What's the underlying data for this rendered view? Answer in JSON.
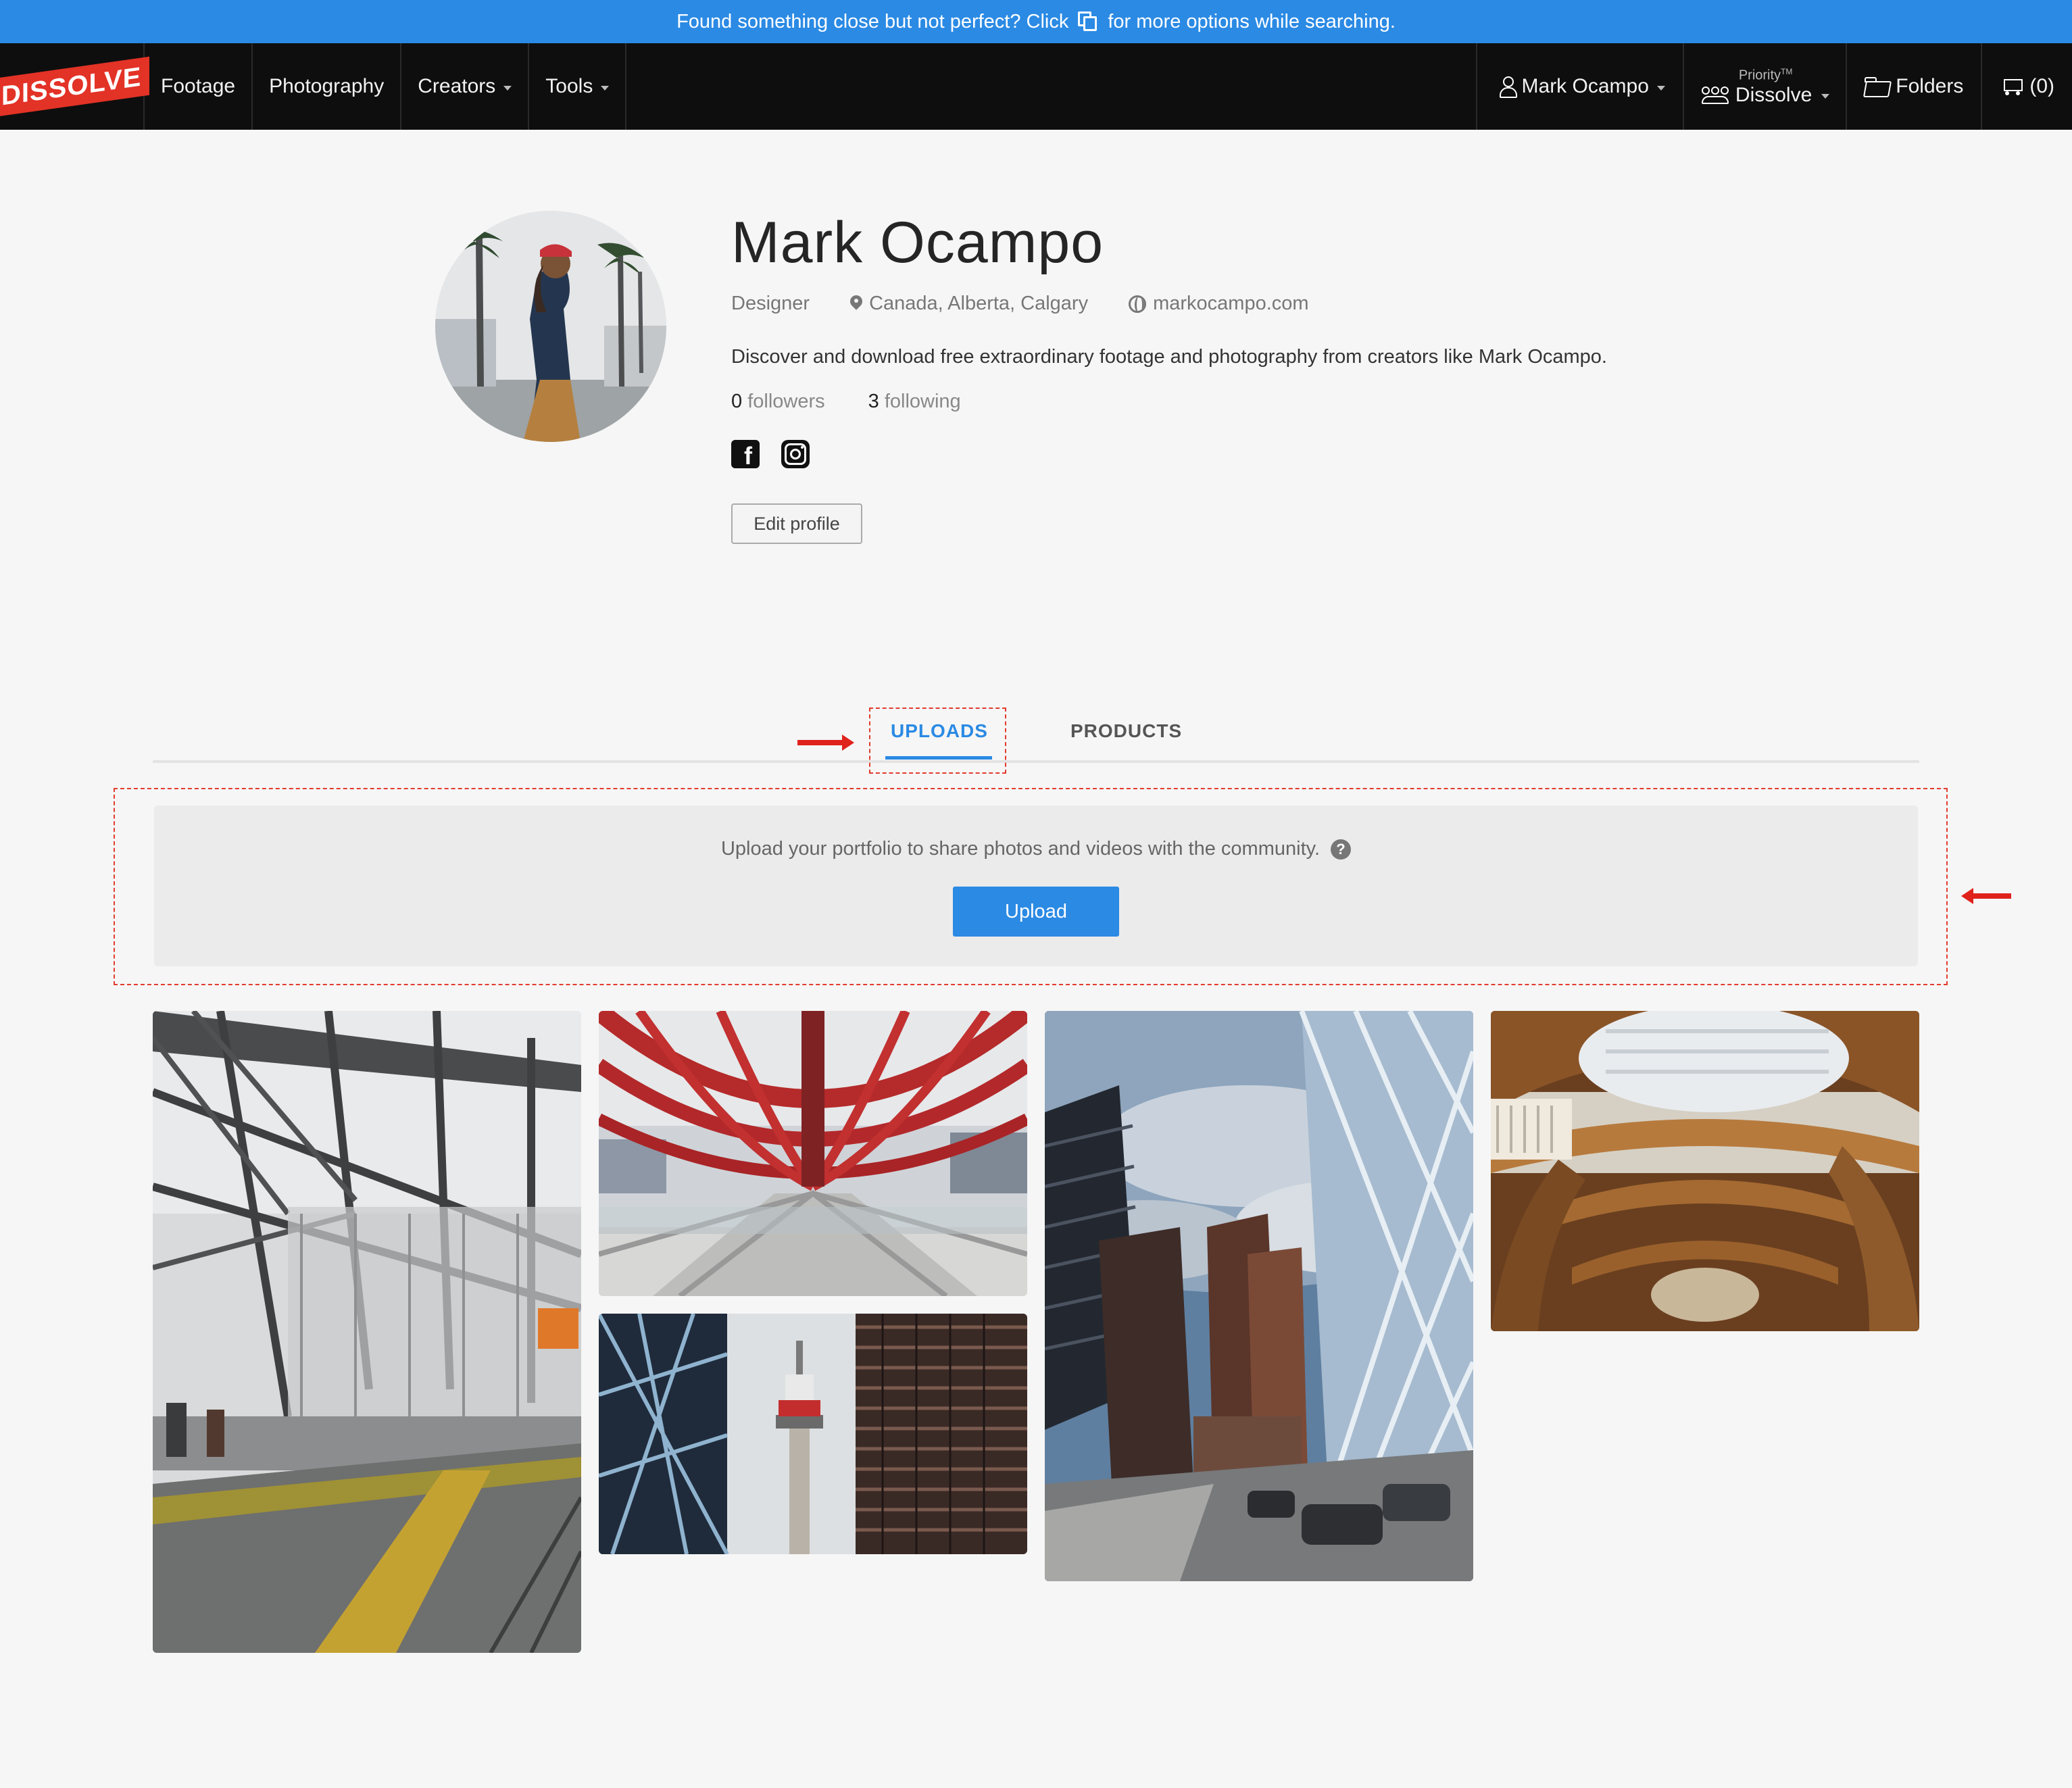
{
  "notice": {
    "text_before": "Found something close but not perfect? Click",
    "icon": "copy-icon",
    "text_after": "for more options while searching."
  },
  "navbar": {
    "logo": "DISSOLVE",
    "items": [
      {
        "label": "Footage",
        "dropdown": false
      },
      {
        "label": "Photography",
        "dropdown": false
      },
      {
        "label": "Creators",
        "dropdown": true
      },
      {
        "label": "Tools",
        "dropdown": true
      }
    ],
    "user": {
      "label": "Mark Ocampo",
      "icon": "user-icon"
    },
    "priority": {
      "small": "Priority",
      "tm": "TM",
      "label": "Dissolve",
      "icon": "team-icon"
    },
    "folders": {
      "label": "Folders",
      "icon": "folder-icon"
    },
    "cart": {
      "label": "(0)",
      "icon": "cart-icon"
    }
  },
  "profile": {
    "name": "Mark Ocampo",
    "role": "Designer",
    "location": "Canada, Alberta, Calgary",
    "website": "markocampo.com",
    "bio": "Discover and download free extraordinary footage and photography from creators like Mark Ocampo.",
    "followers_count": "0",
    "followers_label": "followers",
    "following_count": "3",
    "following_label": "following",
    "social": [
      "facebook-icon",
      "instagram-icon"
    ],
    "edit_label": "Edit profile"
  },
  "tabs": [
    {
      "label": "UPLOADS",
      "active": true
    },
    {
      "label": "PRODUCTS",
      "active": false
    }
  ],
  "upload_panel": {
    "message": "Upload your portfolio to share photos and videos with the community.",
    "help_icon": "?",
    "button_label": "Upload"
  },
  "photos": [
    {
      "subject": "train-platform-snow"
    },
    {
      "subject": "red-peace-bridge"
    },
    {
      "subject": "calgary-tower"
    },
    {
      "subject": "downtown-skyscrapers"
    },
    {
      "subject": "library-interior"
    }
  ],
  "colors": {
    "accent": "#2b8ae4",
    "navbar": "#0e0e0e",
    "logo": "#e33226",
    "annotation": "#e0221c"
  }
}
